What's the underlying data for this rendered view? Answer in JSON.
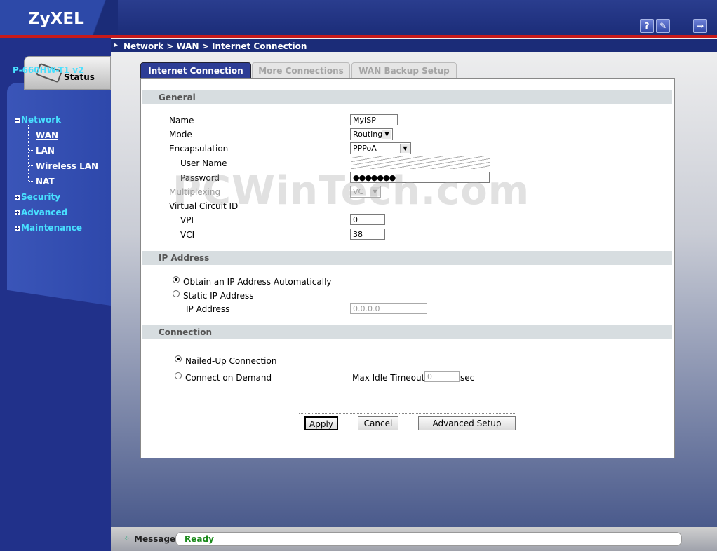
{
  "header": {
    "logo": "ZyXEL",
    "help_icon_glyph": "?",
    "wizard_icon_glyph": "✎",
    "logout_icon_glyph": "→"
  },
  "sidebar": {
    "status_tab": "Status",
    "model": "P-660HW-T1 v2",
    "tree": {
      "network": "Network",
      "wan": "WAN",
      "lan": "LAN",
      "wireless_lan": "Wireless LAN",
      "nat": "NAT",
      "security": "Security",
      "advanced": "Advanced",
      "maintenance": "Maintenance"
    }
  },
  "breadcrumb": "Network > WAN > Internet Connection",
  "tabs": [
    {
      "label": "Internet Connection",
      "active": true
    },
    {
      "label": "More Connections",
      "active": false
    },
    {
      "label": "WAN Backup Setup",
      "active": false
    }
  ],
  "general": {
    "heading": "General",
    "name_label": "Name",
    "name_value": "MyISP",
    "mode_label": "Mode",
    "mode_value": "Routing",
    "encapsulation_label": "Encapsulation",
    "encapsulation_value": "PPPoA",
    "username_label": "User Name",
    "password_label": "Password",
    "password_value": "●●●●●●●",
    "multiplexing_label": "Multiplexing",
    "multiplexing_value": "VC",
    "vcid_label": "Virtual Circuit ID",
    "vpi_label": "VPI",
    "vpi_value": "0",
    "vci_label": "VCI",
    "vci_value": "38"
  },
  "ip_address": {
    "heading": "IP Address",
    "auto_label": "Obtain an IP Address Automatically",
    "static_label": "Static IP Address",
    "ip_label": "IP Address",
    "ip_value": "0.0.0.0",
    "selected": "auto"
  },
  "connection": {
    "heading": "Connection",
    "nailed_label": "Nailed-Up Connection",
    "demand_label": "Connect on Demand",
    "idle_label": "Max Idle Timeout",
    "idle_value": "0",
    "idle_unit": "sec",
    "selected": "nailed"
  },
  "buttons": {
    "apply": "Apply",
    "cancel": "Cancel",
    "advanced_setup": "Advanced Setup"
  },
  "watermark": "PCWinTech.com",
  "message": {
    "label": "Message",
    "text": "Ready"
  }
}
